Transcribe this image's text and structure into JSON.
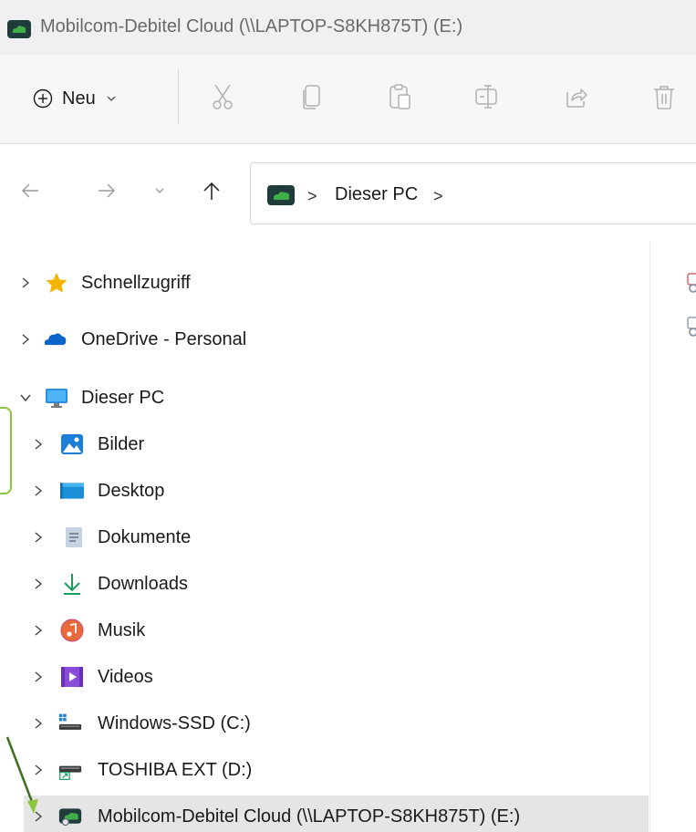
{
  "window": {
    "title": "Mobilcom-Debitel Cloud (\\\\LAPTOP-S8KH875T) (E:)",
    "app_icon": "cloud-drive-icon"
  },
  "toolbar": {
    "new_label": "Neu",
    "items": [
      "cut-icon",
      "copy-icon",
      "paste-icon",
      "rename-icon",
      "share-icon",
      "delete-icon"
    ]
  },
  "navigation": {
    "back": "back-arrow-icon",
    "forward": "forward-arrow-icon",
    "recent": "chevron-down-icon",
    "up": "up-arrow-icon"
  },
  "address": {
    "path_label": "Dieser PC",
    "separator": ">"
  },
  "tree": {
    "quick_access": "Schnellzugriff",
    "onedrive": "OneDrive - Personal",
    "this_pc": "Dieser PC",
    "pictures": "Bilder",
    "desktop": "Desktop",
    "documents": "Dokumente",
    "downloads": "Downloads",
    "music": "Musik",
    "videos": "Videos",
    "drive_c": "Windows-SSD (C:)",
    "drive_d": "TOSHIBA EXT (D:)",
    "drive_e": "Mobilcom-Debitel Cloud (\\\\LAPTOP-S8KH875T) (E:)"
  },
  "colors": {
    "accent_annotation": "#8cc63f",
    "cloud_green": "#3fae49",
    "selection": "#e5e5e5"
  }
}
